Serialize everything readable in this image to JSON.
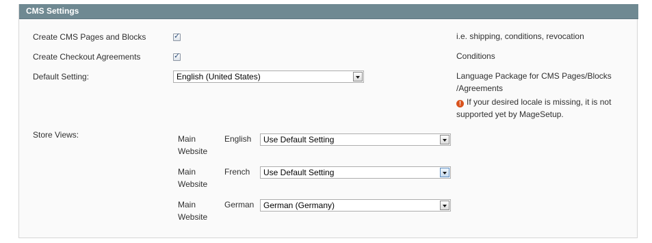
{
  "section": {
    "title": "CMS Settings"
  },
  "rows": {
    "cms_pages": {
      "label": "Create CMS Pages and Blocks",
      "checked": true,
      "note": "i.e. shipping, conditions, revocation"
    },
    "checkout": {
      "label": "Create Checkout Agreements",
      "checked": true,
      "note": "Conditions"
    },
    "default_setting": {
      "label": "Default Setting:",
      "value": "English (United States)",
      "note_line1": "Language Package for CMS Pages/Blocks",
      "note_line2": "/Agreements",
      "warning_line1": "If your desired locale is missing, it is not",
      "warning_line2": "supported yet by MageSetup."
    }
  },
  "store_views": {
    "label": "Store Views:",
    "items": [
      {
        "website_line1": "Main",
        "website_line2": "Website",
        "language": "English",
        "value": "Use Default Setting"
      },
      {
        "website_line1": "Main",
        "website_line2": "Website",
        "language": "French",
        "value": "Use Default Setting"
      },
      {
        "website_line1": "Main",
        "website_line2": "Website",
        "language": "German",
        "value": "German (Germany)"
      }
    ]
  },
  "icons": {
    "checkbox": "check-icon",
    "warning": "error-icon",
    "dropdown": "chevron-down-icon"
  }
}
